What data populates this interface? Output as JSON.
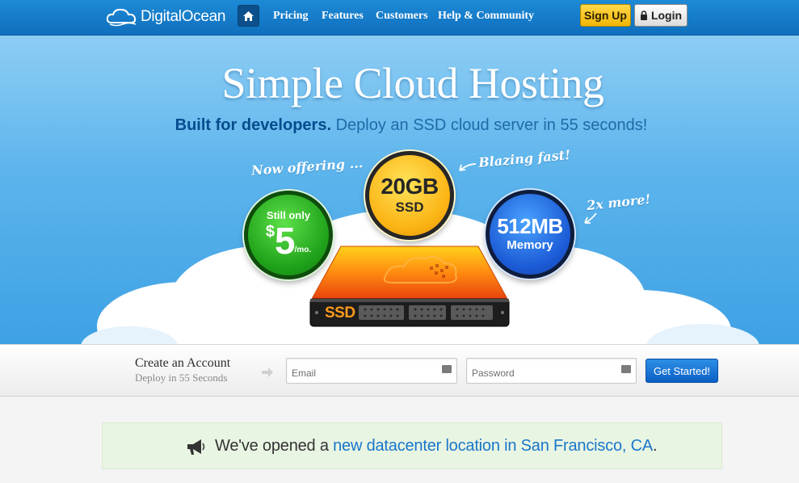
{
  "nav": {
    "logo_text": "DigitalOcean",
    "home_icon": "home-icon",
    "links": [
      "Pricing",
      "Features",
      "Customers",
      "Help & Community"
    ],
    "signup": "Sign Up",
    "login": "Login",
    "login_icon": "lock-icon"
  },
  "hero": {
    "title": "Simple Cloud Hosting",
    "subtitle_bold": "Built for developers.",
    "subtitle_rest": " Deploy an SSD cloud server in 55 seconds!",
    "annotations": {
      "now_offering": "Now offering ...",
      "blazing": "Blazing fast!",
      "more": "2x more!"
    },
    "price": {
      "label": "Still only",
      "currency": "$",
      "amount": "5",
      "period": "/mo."
    },
    "storage": {
      "value": "20GB",
      "type": "SSD"
    },
    "memory": {
      "value": "512MB",
      "label": "Memory"
    },
    "server_label": "SSD"
  },
  "signup_band": {
    "title": "Create an Account",
    "subtitle": "Deploy in 55 Seconds",
    "email_placeholder": "Email",
    "password_placeholder": "Password",
    "submit": "Get Started!"
  },
  "notice": {
    "icon": "megaphone-icon",
    "text": "We've opened a ",
    "link": "new datacenter location in San Francisco, CA",
    "suffix": "."
  },
  "colors": {
    "nav_bg": "#1479c9",
    "signup_yellow": "#f8c51c",
    "cta_blue": "#1a73d4",
    "notice_bg": "#e9f5e3",
    "link_blue": "#1877c9"
  }
}
